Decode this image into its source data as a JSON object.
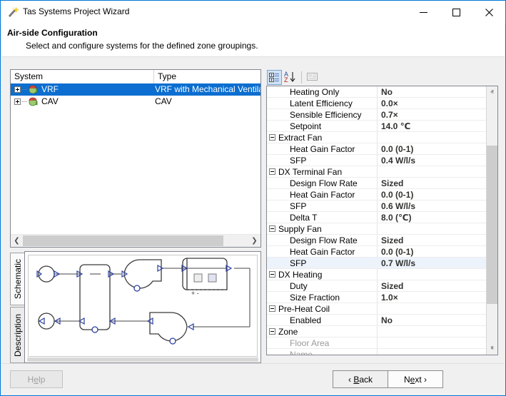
{
  "window": {
    "title": "Tas Systems Project Wizard",
    "icon": "wizard-wand-icon",
    "minimize_label": "–",
    "maximize_label": "□",
    "close_label": "✕"
  },
  "header": {
    "title": "Air-side Configuration",
    "subtitle": "Select and configure systems for the defined zone groupings."
  },
  "tree": {
    "columns": [
      "System",
      "Type"
    ],
    "rows": [
      {
        "label": "VRF",
        "type": "VRF with Mechanical Ventilation",
        "selected": true
      },
      {
        "label": "CAV",
        "type": "CAV",
        "selected": false
      }
    ],
    "scroll_left_arrow": "❮",
    "scroll_right_arrow": "❯"
  },
  "schematic_tabs": [
    {
      "label": "Schematic",
      "selected": true
    },
    {
      "label": "Description",
      "selected": false
    }
  ],
  "property_toolbar": {
    "categorized_label": "categorized-view-icon",
    "alphabetical_label": "alphabetical-sort-icon",
    "property_pages_label": "property-pages-icon"
  },
  "properties": {
    "rows": [
      {
        "kind": "prop",
        "indent": 1,
        "name": "Heating Only",
        "value": "No",
        "dim": false,
        "selected": false
      },
      {
        "kind": "prop",
        "indent": 1,
        "name": "Latent Efficiency",
        "value": "0.0×",
        "dim": false,
        "selected": false
      },
      {
        "kind": "prop",
        "indent": 1,
        "name": "Sensible Efficiency",
        "value": "0.7×",
        "dim": false,
        "selected": false
      },
      {
        "kind": "prop",
        "indent": 1,
        "name": "Setpoint",
        "value": "14.0 ℃",
        "dim": false,
        "selected": false
      },
      {
        "kind": "cat",
        "indent": 0,
        "name": "Extract Fan",
        "value": "",
        "dim": false,
        "selected": false
      },
      {
        "kind": "prop",
        "indent": 1,
        "name": "Heat Gain Factor",
        "value": "0.0 (0-1)",
        "dim": false,
        "selected": false
      },
      {
        "kind": "prop",
        "indent": 1,
        "name": "SFP",
        "value": "0.4 W/l/s",
        "dim": false,
        "selected": false
      },
      {
        "kind": "cat",
        "indent": 0,
        "name": "DX Terminal Fan",
        "value": "",
        "dim": false,
        "selected": false
      },
      {
        "kind": "prop",
        "indent": 1,
        "name": "Design Flow Rate",
        "value": "Sized",
        "dim": false,
        "selected": false
      },
      {
        "kind": "prop",
        "indent": 1,
        "name": "Heat Gain Factor",
        "value": "0.0 (0-1)",
        "dim": false,
        "selected": false
      },
      {
        "kind": "prop",
        "indent": 1,
        "name": "SFP",
        "value": "0.6 W/l/s",
        "dim": false,
        "selected": false
      },
      {
        "kind": "prop",
        "indent": 1,
        "name": "Delta T",
        "value": "8.0 (℃)",
        "dim": false,
        "selected": false
      },
      {
        "kind": "cat",
        "indent": 0,
        "name": "Supply Fan",
        "value": "",
        "dim": false,
        "selected": false
      },
      {
        "kind": "prop",
        "indent": 1,
        "name": "Design Flow Rate",
        "value": "Sized",
        "dim": false,
        "selected": false
      },
      {
        "kind": "prop",
        "indent": 1,
        "name": "Heat Gain Factor",
        "value": "0.0 (0-1)",
        "dim": false,
        "selected": false
      },
      {
        "kind": "prop",
        "indent": 1,
        "name": "SFP",
        "value": "0.7 W/l/s",
        "dim": false,
        "selected": true
      },
      {
        "kind": "cat",
        "indent": 0,
        "name": "DX Heating",
        "value": "",
        "dim": false,
        "selected": false
      },
      {
        "kind": "prop",
        "indent": 1,
        "name": "Duty",
        "value": "Sized",
        "dim": false,
        "selected": false
      },
      {
        "kind": "prop",
        "indent": 1,
        "name": "Size Fraction",
        "value": "1.0×",
        "dim": false,
        "selected": false
      },
      {
        "kind": "cat",
        "indent": 0,
        "name": "Pre-Heat Coil",
        "value": "",
        "dim": false,
        "selected": false
      },
      {
        "kind": "prop",
        "indent": 1,
        "name": "Enabled",
        "value": "No",
        "dim": false,
        "selected": false
      },
      {
        "kind": "cat",
        "indent": 0,
        "name": "Zone",
        "value": "",
        "dim": false,
        "selected": false
      },
      {
        "kind": "prop",
        "indent": 1,
        "name": "Floor Area",
        "value": "",
        "dim": true,
        "selected": false
      },
      {
        "kind": "prop",
        "indent": 1,
        "name": "Name",
        "value": "",
        "dim": true,
        "selected": false
      }
    ],
    "scroll_up_arrow": "ⱏ",
    "scroll_down_arrow": "ⱝ"
  },
  "footer": {
    "help": {
      "pre": "H",
      "accel": "e",
      "post": "lp"
    },
    "back": {
      "pre": "‹ ",
      "accel": "B",
      "post": "ack"
    },
    "next": {
      "pre": "N",
      "accel": "e",
      "post": "xt ›"
    }
  },
  "colors": {
    "accent": "#0078d7",
    "selection": "#0b6ed0",
    "row_selection": "#ecf3fb",
    "value_text": "#31312f",
    "disabled_text": "#9a9a9a"
  }
}
